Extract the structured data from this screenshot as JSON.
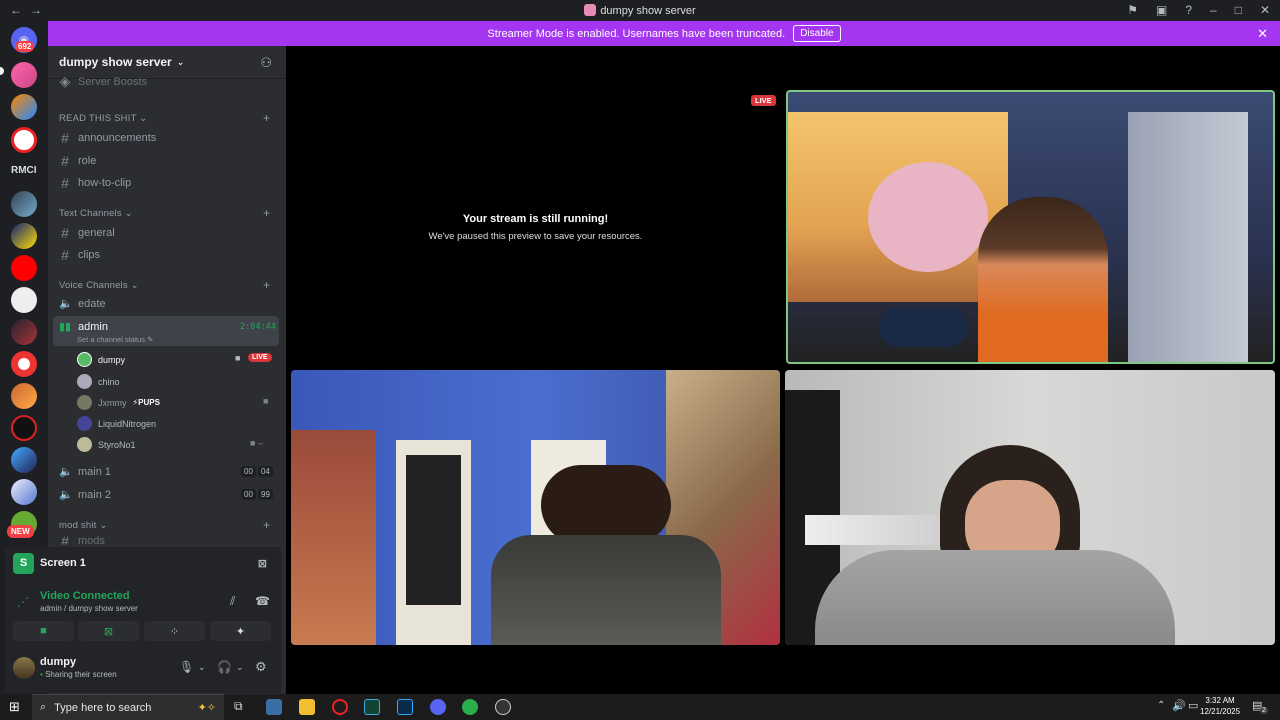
{
  "window": {
    "title": "dumpy show server"
  },
  "banner": {
    "text": "Streamer Mode is enabled. Usernames have been truncated.",
    "disable_label": "Disable"
  },
  "servers": {
    "mention_count": "692",
    "new_label": "NEW",
    "rmci_label": "RMCI"
  },
  "server": {
    "name": "dumpy show server"
  },
  "channels": {
    "top_item": "Server Boosts",
    "categories": [
      {
        "label": "READ THIS SHIT",
        "items": [
          "announcements",
          "role",
          "how-to-clip"
        ]
      },
      {
        "label": "Text Channels",
        "items": [
          "general",
          "clips"
        ]
      },
      {
        "label": "Voice Channels"
      },
      {
        "label": "mod shit",
        "items": [
          "mods"
        ]
      }
    ],
    "voice": [
      {
        "name": "edate"
      },
      {
        "name": "admin",
        "timer": "2:04:44",
        "status": "Set a channel status"
      },
      {
        "name": "main 1",
        "count": "00",
        "limit": "04"
      },
      {
        "name": "main 2",
        "count": "00",
        "limit": "99"
      }
    ],
    "admin_users": [
      {
        "name": "dumpy",
        "live": "LIVE"
      },
      {
        "name": "chino"
      },
      {
        "name": "Jxmmy",
        "tag": "PUPS"
      },
      {
        "name": "LiquidNitrogen"
      },
      {
        "name": "StyroNo1"
      }
    ]
  },
  "panel": {
    "screen_label": "Screen 1",
    "status": "Video Connected",
    "status_sub": "admin / dumpy show server",
    "user": "dumpy",
    "user_status": "Sharing their screen"
  },
  "stream": {
    "paused_title": "Your stream is still running!",
    "paused_sub": "We've paused this preview to save your resources.",
    "live_label": "LIVE"
  },
  "taskbar": {
    "search_placeholder": "Type here to search",
    "time": "3:32 AM",
    "date": "12/21/2025",
    "notif_count": "2"
  },
  "colors": {
    "accent": "#a435f0",
    "green": "#23a55a",
    "red": "#da373c",
    "blurple": "#5865f2"
  }
}
